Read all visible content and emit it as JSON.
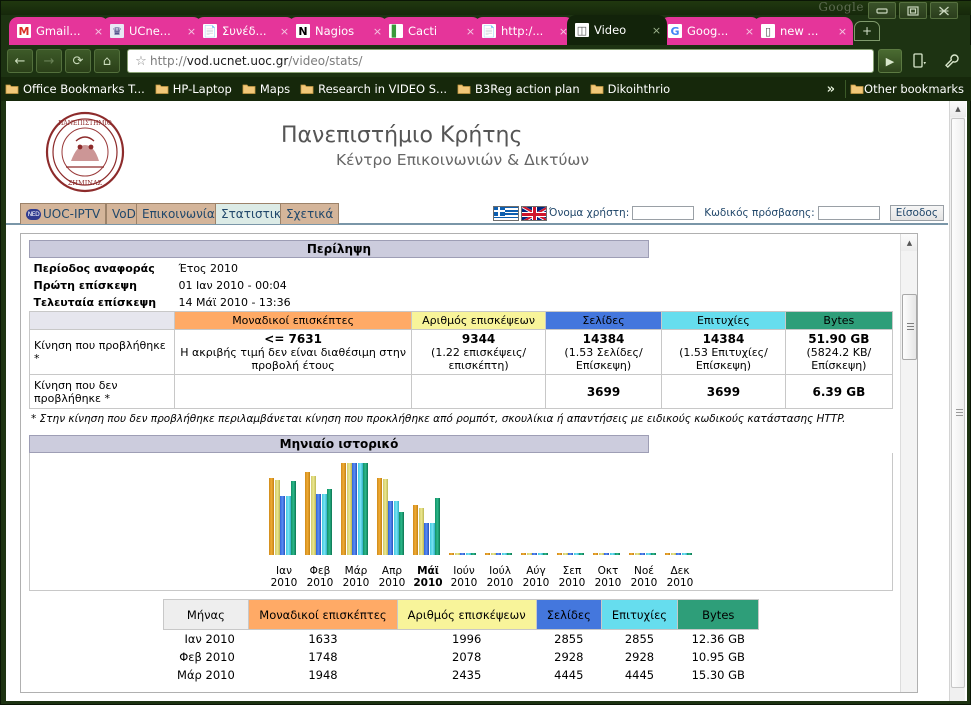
{
  "window": {
    "watermark": "Google",
    "minimize_label": "minimize-window",
    "maximize_label": "maximize-window",
    "close_label": "close-window"
  },
  "tabs": [
    {
      "title": "Gmail...",
      "icon": "gmail-icon",
      "active": false,
      "close": "×"
    },
    {
      "title": "UCne...",
      "icon": "ucnet-icon",
      "active": false,
      "close": "×"
    },
    {
      "title": "Συνέδ...",
      "icon": "document-icon",
      "active": false,
      "close": "×"
    },
    {
      "title": "Nagios",
      "icon": "nagios-icon",
      "active": false,
      "close": "×"
    },
    {
      "title": "Cacti",
      "icon": "cacti-icon",
      "active": false,
      "close": "×"
    },
    {
      "title": "http:/...",
      "icon": "document-icon",
      "active": false,
      "close": "×"
    },
    {
      "title": "Video",
      "icon": "video-stack-icon",
      "active": true,
      "close": "×"
    },
    {
      "title": "Goog...",
      "icon": "google-icon",
      "active": false,
      "close": "×"
    },
    {
      "title": "new ...",
      "icon": "window-icon",
      "active": false,
      "close": "×"
    }
  ],
  "newtab_label": "+",
  "toolbar": {
    "back": "←",
    "forward": "→",
    "reload": "⟳",
    "home": "⌂",
    "star": "☆",
    "url_prefix": "http://",
    "url_domain": "vod.ucnet.uoc.gr",
    "url_path": "/video/stats/",
    "url_full": "http://vod.ucnet.uoc.gr/video/stats/",
    "go": "▶",
    "page_menu": "⎘",
    "wrench_menu": "🔧"
  },
  "bookmarks": {
    "items": [
      {
        "label": "Office Bookmarks T..."
      },
      {
        "label": "HP-Laptop"
      },
      {
        "label": "Maps"
      },
      {
        "label": "Research in VIDEO S..."
      },
      {
        "label": "B3Reg action plan"
      },
      {
        "label": "Dikoihthrio"
      }
    ],
    "overflow": "»",
    "other": "Other bookmarks"
  },
  "site": {
    "title": "Πανεπιστήμιο Κρήτης",
    "subtitle": "Κέντρο Επικοινωνιών & Δικτύων",
    "logo_alt": "university-of-crete-seal"
  },
  "nav": {
    "badge": "NED",
    "items": [
      {
        "label": "UOC-IPTV",
        "selected": false
      },
      {
        "label": "VoD",
        "selected": false
      },
      {
        "label": "Επικοινωνία",
        "selected": false
      },
      {
        "label": "Στατιστικά",
        "selected": true
      },
      {
        "label": "Σχετικά",
        "selected": false
      }
    ]
  },
  "login": {
    "flag_gr": "greek-flag",
    "flag_en": "uk-flag",
    "username_label": "Όνομα χρήστη:",
    "username_value": "",
    "password_label": "Κωδικός πρόσβασης:",
    "password_value": "",
    "submit": "Είσοδος"
  },
  "summary": {
    "section_title": "Περίληψη",
    "meta": [
      {
        "label": "Περίοδος αναφοράς",
        "value": "Έτος 2010"
      },
      {
        "label": "Πρώτη επίσκεψη",
        "value": "01 Ιαν 2010 - 00:04"
      },
      {
        "label": "Τελευταία επίσκεψη",
        "value": "14 Μάϊ 2010 - 13:36"
      }
    ],
    "headers": [
      {
        "label": "",
        "color": "#e6e6ee"
      },
      {
        "label": "Μοναδικοί επισκέπτες",
        "color": "#ffaa66"
      },
      {
        "label": "Αριθμός επισκέψεων",
        "color": "#f8f49a"
      },
      {
        "label": "Σελίδες",
        "color": "#4477dd"
      },
      {
        "label": "Επιτυχίες",
        "color": "#66ddee"
      },
      {
        "label": "Bytes",
        "color": "#2e9e79"
      }
    ],
    "row_viewed": {
      "label": "Κίνηση που προβλήθηκε *",
      "unique_main": "<= 7631",
      "unique_note": "Η ακριβής τιμή δεν είναι διαθέσιμη στην προβολή έτους",
      "visits_main": "9344",
      "visits_note": "(1.22 επισκέψεις/επισκέπτη)",
      "pages_main": "14384",
      "pages_note": "(1.53 Σελίδες/Επίσκεψη)",
      "hits_main": "14384",
      "hits_note": "(1.53 Επιτυχίες/Επίσκεψη)",
      "bytes_main": "51.90 GB",
      "bytes_note": "(5824.2 ΚΒ/Επίσκεψη)"
    },
    "row_not_viewed": {
      "label": "Κίνηση που δεν προβλήθηκε *",
      "unique": "",
      "visits": "",
      "pages": "3699",
      "hits": "3699",
      "bytes": "6.39 GB"
    },
    "footnote": "* Στην κίνηση που δεν προβλήθηκε περιλαμβάνεται κίνηση που προκλήθηκε από ρομπότ, σκουλίκια ή απαντήσεις με ειδικούς κωδικούς κατάστασης HTTP."
  },
  "monthly": {
    "section_title": "Μηνιαίο ιστορικό",
    "table_headers": [
      {
        "label": "Μήνας",
        "color": "#eeeeee"
      },
      {
        "label": "Μοναδικοί επισκέπτες",
        "color": "#ffaa66"
      },
      {
        "label": "Αριθμός επισκέψεων",
        "color": "#f8f49a"
      },
      {
        "label": "Σελίδες",
        "color": "#4477dd"
      },
      {
        "label": "Επιτυχίες",
        "color": "#66ddee"
      },
      {
        "label": "Bytes",
        "color": "#2e9e79"
      }
    ],
    "rows": [
      {
        "month": "Ιαν 2010",
        "unique": "1633",
        "visits": "1996",
        "pages": "2855",
        "hits": "2855",
        "bytes": "12.36 GB"
      },
      {
        "month": "Φεβ 2010",
        "unique": "1748",
        "visits": "2078",
        "pages": "2928",
        "hits": "2928",
        "bytes": "10.95 GB"
      },
      {
        "month": "Μάρ 2010",
        "unique": "1948",
        "visits": "2435",
        "pages": "4445",
        "hits": "4445",
        "bytes": "15.30 GB"
      }
    ]
  },
  "chart_data": {
    "type": "bar",
    "title": "Μηνιαίο ιστορικό",
    "xlabel": "",
    "ylabel": "",
    "grid": false,
    "legend_position": "none",
    "categories": [
      "Ιαν 2010",
      "Φεβ 2010",
      "Μάρ 2010",
      "Απρ 2010",
      "Μάϊ 2010",
      "Ιούν 2010",
      "Ιούλ 2010",
      "Αύγ 2010",
      "Σεπ 2010",
      "Οκτ 2010",
      "Νοέ 2010",
      "Δεκ 2010"
    ],
    "current_category": "Μάϊ 2010",
    "series": [
      {
        "name": "Μοναδικοί επισκέπτες",
        "color": "#f0ab34",
        "values": [
          1633,
          1748,
          1948,
          1637,
          1065,
          0,
          0,
          0,
          0,
          0,
          0,
          0
        ]
      },
      {
        "name": "Αριθμός επισκέψεων",
        "color": "#ece78f",
        "values": [
          1996,
          2078,
          2435,
          2024,
          1236,
          0,
          0,
          0,
          0,
          0,
          0,
          0
        ]
      },
      {
        "name": "Σελίδες",
        "color": "#5a8cf5",
        "values": [
          2855,
          2928,
          4445,
          2603,
          1553,
          0,
          0,
          0,
          0,
          0,
          0,
          0
        ]
      },
      {
        "name": "Επιτυχίες",
        "color": "#7ae4f4",
        "values": [
          2855,
          2928,
          4445,
          2603,
          1553,
          0,
          0,
          0,
          0,
          0,
          0,
          0
        ]
      },
      {
        "name": "Bytes",
        "color": "#2bb98a",
        "values": [
          12.36,
          10.95,
          15.3,
          7.11,
          9.43,
          0,
          0,
          0,
          0,
          0,
          0,
          0
        ]
      }
    ]
  }
}
